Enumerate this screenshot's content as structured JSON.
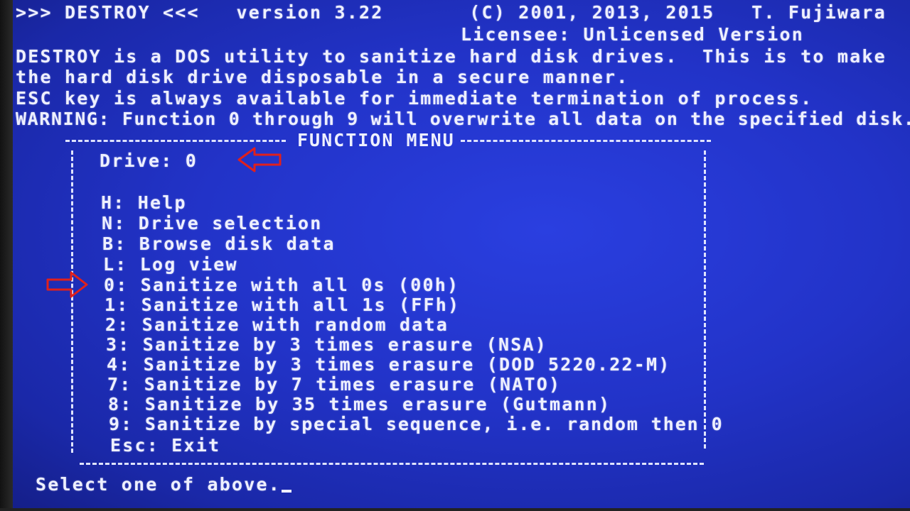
{
  "header": {
    "title_line": ">>> DESTROY <<<   version 3.22       (C) 2001, 2013, 2015   T. Fujiwara",
    "licensee_line": "Licensee: Unlicensed Version",
    "desc_line1": "DESTROY is a DOS utility to sanitize hard disk drives.  This is to make",
    "desc_line2": "the hard disk drive disposable in a secure manner.",
    "esc_line": "ESC key is always available for immediate termination of process.",
    "warning_line": "WARNING: Function 0 through 9 will overwrite all data on the specified disk."
  },
  "menu": {
    "title": "FUNCTION MENU",
    "drive_label": "Drive: 0",
    "items": [
      {
        "label": "H: Help"
      },
      {
        "label": "N: Drive selection"
      },
      {
        "label": "B: Browse disk data"
      },
      {
        "label": "L: Log view"
      },
      {
        "label": "0: Sanitize with all 0s (00h)"
      },
      {
        "label": "1: Sanitize with all 1s (FFh)"
      },
      {
        "label": "2: Sanitize with random data"
      },
      {
        "label": "3: Sanitize by 3 times erasure (NSA)"
      },
      {
        "label": "4: Sanitize by 3 times erasure (DOD 5220.22-M)"
      },
      {
        "label": "7: Sanitize by 7 times erasure (NATO)"
      },
      {
        "label": "8: Sanitize by 35 times erasure (Gutmann)"
      },
      {
        "label": "9: Sanitize by special sequence, i.e. random then 0"
      },
      {
        "label": "Esc: Exit"
      }
    ]
  },
  "prompt": {
    "text": "Select one of above."
  },
  "colors": {
    "background": "#2233c8",
    "text": "#eef0ff",
    "annotation_arrow": "#e0201c"
  },
  "icons": {
    "drive_arrow": "left-arrow-outline",
    "item_arrow": "right-arrow-outline"
  }
}
